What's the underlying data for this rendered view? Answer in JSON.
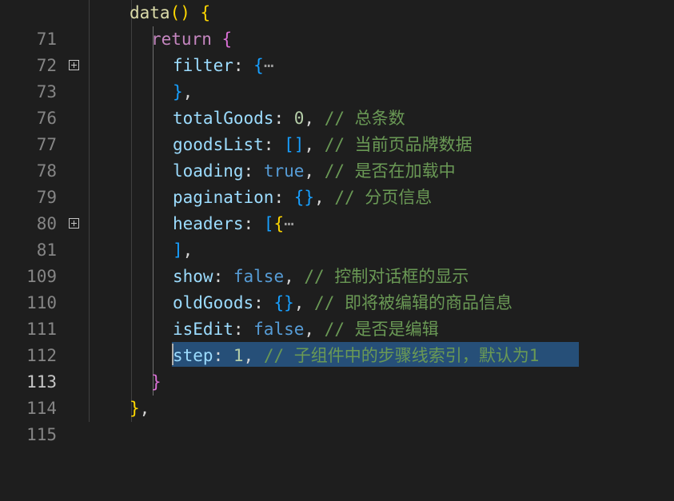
{
  "gutter": {
    "line_numbers": [
      "71",
      "72",
      "73",
      "76",
      "77",
      "78",
      "79",
      "80",
      "81",
      "109",
      "110",
      "111",
      "112",
      "113",
      "114",
      "115"
    ],
    "active_line": "113"
  },
  "code": {
    "l71": {
      "fn": "data",
      "p1": "()",
      "p2": " {"
    },
    "l72": {
      "kw": "return",
      "p": " {"
    },
    "l73": {
      "prop": "filter",
      "colon": ": ",
      "brace": "{",
      "ellipsis": "⋯"
    },
    "l76": {
      "brace": "}",
      "p": ","
    },
    "l77": {
      "prop": "totalGoods",
      "colon": ": ",
      "val": "0",
      "p": ", ",
      "cmt": "// 总条数"
    },
    "l78": {
      "prop": "goodsList",
      "colon": ": ",
      "val": "[]",
      "p": ", ",
      "cmt": "// 当前页品牌数据"
    },
    "l79": {
      "prop": "loading",
      "colon": ": ",
      "val": "true",
      "p": ", ",
      "cmt": "// 是否在加载中"
    },
    "l80": {
      "prop": "pagination",
      "colon": ": ",
      "val": "{}",
      "p": ", ",
      "cmt": "// 分页信息"
    },
    "l81": {
      "prop": "headers",
      "colon": ": ",
      "bracket": "[",
      "brace": "{",
      "ellipsis": "⋯"
    },
    "l109": {
      "bracket": "]",
      "p": ","
    },
    "l110": {
      "prop": "show",
      "colon": ": ",
      "val": "false",
      "p": ", ",
      "cmt": "// 控制对话框的显示"
    },
    "l111": {
      "prop": "oldGoods",
      "colon": ": ",
      "val": "{}",
      "p": ", ",
      "cmt": "// 即将被编辑的商品信息"
    },
    "l112": {
      "prop": "isEdit",
      "colon": ": ",
      "val": "false",
      "p": ", ",
      "cmt": "// 是否是编辑"
    },
    "l113": {
      "prop": "step",
      "colon": ": ",
      "val": "1",
      "p": ", ",
      "cmt": "// 子组件中的步骤线索引，默认为1"
    },
    "l114": {
      "brace": "}"
    },
    "l115": {
      "brace": "}",
      "p": ","
    }
  },
  "colors": {
    "background": "#1e1e1e",
    "selection": "#264f78",
    "property": "#9cdcfe",
    "keyword": "#c586c0",
    "function": "#dcdcaa",
    "number": "#b5cea8",
    "boolean": "#569cd6",
    "comment": "#6a9955"
  }
}
